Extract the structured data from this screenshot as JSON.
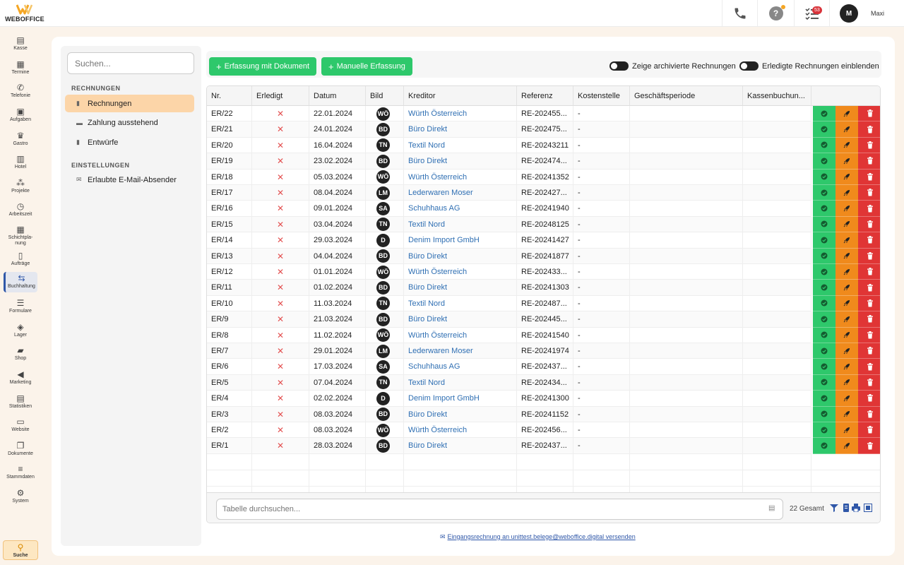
{
  "app": {
    "brand": "WEBOFFICE",
    "accent": "#f5a623"
  },
  "topbar": {
    "notification_count": "53",
    "user_initial": "M",
    "user_name": "Maxi",
    "icons": [
      "phone-icon",
      "help-icon",
      "tasks-icon",
      "avatar"
    ]
  },
  "sidenav": {
    "items": [
      {
        "label": "Kasse",
        "icon": "register-icon"
      },
      {
        "label": "Termine",
        "icon": "calendar-icon"
      },
      {
        "label": "Telefonie",
        "icon": "phone-icon"
      },
      {
        "label": "Aufgaben",
        "icon": "tasks-icon"
      },
      {
        "label": "Gastro",
        "icon": "crown-icon"
      },
      {
        "label": "Hotel",
        "icon": "hotel-icon"
      },
      {
        "label": "Projekte",
        "icon": "projects-icon"
      },
      {
        "label": "Arbeitszeit",
        "icon": "clock-icon"
      },
      {
        "label": "Schichtpla-nung",
        "icon": "shift-icon"
      },
      {
        "label": "Aufträge",
        "icon": "orders-icon"
      },
      {
        "label": "Buchhaltung",
        "icon": "accounting-icon",
        "active": true
      },
      {
        "label": "Formulare",
        "icon": "forms-icon"
      },
      {
        "label": "Lager",
        "icon": "storage-icon"
      },
      {
        "label": "Shop",
        "icon": "shop-icon"
      },
      {
        "label": "Marketing",
        "icon": "megaphone-icon"
      },
      {
        "label": "Statistiken",
        "icon": "stats-icon"
      },
      {
        "label": "Website",
        "icon": "website-icon"
      },
      {
        "label": "Dokumente",
        "icon": "documents-icon"
      },
      {
        "label": "Stammdaten",
        "icon": "database-icon"
      },
      {
        "label": "System",
        "icon": "gear-icon"
      }
    ],
    "search_label": "Suche"
  },
  "leftpanel": {
    "search_placeholder": "Suchen...",
    "section_invoices": "RECHNUNGEN",
    "items": [
      "Rechnungen",
      "Zahlung ausstehend",
      "Entwürfe"
    ],
    "section_settings": "EINSTELLUNGEN",
    "settings_items": [
      "Erlaubte E-Mail-Absender"
    ]
  },
  "toolbar": {
    "btn_document": "Erfassung mit Dokument",
    "btn_manual": "Manuelle Erfassung",
    "toggle_archived": "Zeige archivierte Rechnungen",
    "toggle_done": "Erledigte Rechnungen einblenden"
  },
  "table": {
    "columns": [
      "Nr.",
      "Erledigt",
      "Datum",
      "Bild",
      "Kreditor",
      "Referenz",
      "Kostenstelle",
      "Geschäftsperiode",
      "Kassenbuchun..."
    ],
    "rows": [
      {
        "nr": "ER/22",
        "done": "✕",
        "date": "22.01.2024",
        "img": "WÖ",
        "creditor": "Würth Österreich",
        "ref": "RE-202455...",
        "cost": "-"
      },
      {
        "nr": "ER/21",
        "done": "✕",
        "date": "24.01.2024",
        "img": "BD",
        "creditor": "Büro Direkt",
        "ref": "RE-202475...",
        "cost": "-"
      },
      {
        "nr": "ER/20",
        "done": "✕",
        "date": "16.04.2024",
        "img": "TN",
        "creditor": "Textil Nord",
        "ref": "RE-20243211",
        "cost": "-"
      },
      {
        "nr": "ER/19",
        "done": "✕",
        "date": "23.02.2024",
        "img": "BD",
        "creditor": "Büro Direkt",
        "ref": "RE-202474...",
        "cost": "-"
      },
      {
        "nr": "ER/18",
        "done": "✕",
        "date": "05.03.2024",
        "img": "WÖ",
        "creditor": "Würth Österreich",
        "ref": "RE-20241352",
        "cost": "-"
      },
      {
        "nr": "ER/17",
        "done": "✕",
        "date": "08.04.2024",
        "img": "LM",
        "creditor": "Lederwaren Moser",
        "ref": "RE-202427...",
        "cost": "-"
      },
      {
        "nr": "ER/16",
        "done": "✕",
        "date": "09.01.2024",
        "img": "SA",
        "creditor": "Schuhhaus AG",
        "ref": "RE-20241940",
        "cost": "-"
      },
      {
        "nr": "ER/15",
        "done": "✕",
        "date": "03.04.2024",
        "img": "TN",
        "creditor": "Textil Nord",
        "ref": "RE-20248125",
        "cost": "-"
      },
      {
        "nr": "ER/14",
        "done": "✕",
        "date": "29.03.2024",
        "img": "D",
        "creditor": "Denim Import GmbH",
        "ref": "RE-20241427",
        "cost": "-"
      },
      {
        "nr": "ER/13",
        "done": "✕",
        "date": "04.04.2024",
        "img": "BD",
        "creditor": "Büro Direkt",
        "ref": "RE-20241877",
        "cost": "-"
      },
      {
        "nr": "ER/12",
        "done": "✕",
        "date": "01.01.2024",
        "img": "WÖ",
        "creditor": "Würth Österreich",
        "ref": "RE-202433...",
        "cost": "-"
      },
      {
        "nr": "ER/11",
        "done": "✕",
        "date": "01.02.2024",
        "img": "BD",
        "creditor": "Büro Direkt",
        "ref": "RE-20241303",
        "cost": "-"
      },
      {
        "nr": "ER/10",
        "done": "✕",
        "date": "11.03.2024",
        "img": "TN",
        "creditor": "Textil Nord",
        "ref": "RE-202487...",
        "cost": "-"
      },
      {
        "nr": "ER/9",
        "done": "✕",
        "date": "21.03.2024",
        "img": "BD",
        "creditor": "Büro Direkt",
        "ref": "RE-202445...",
        "cost": "-"
      },
      {
        "nr": "ER/8",
        "done": "✕",
        "date": "11.02.2024",
        "img": "WÖ",
        "creditor": "Würth Österreich",
        "ref": "RE-20241540",
        "cost": "-"
      },
      {
        "nr": "ER/7",
        "done": "✕",
        "date": "29.01.2024",
        "img": "LM",
        "creditor": "Lederwaren Moser",
        "ref": "RE-20241974",
        "cost": "-"
      },
      {
        "nr": "ER/6",
        "done": "✕",
        "date": "17.03.2024",
        "img": "SA",
        "creditor": "Schuhhaus AG",
        "ref": "RE-202437...",
        "cost": "-"
      },
      {
        "nr": "ER/5",
        "done": "✕",
        "date": "07.04.2024",
        "img": "TN",
        "creditor": "Textil Nord",
        "ref": "RE-202434...",
        "cost": "-"
      },
      {
        "nr": "ER/4",
        "done": "✕",
        "date": "02.02.2024",
        "img": "D",
        "creditor": "Denim Import GmbH",
        "ref": "RE-20241300",
        "cost": "-"
      },
      {
        "nr": "ER/3",
        "done": "✕",
        "date": "08.03.2024",
        "img": "BD",
        "creditor": "Büro Direkt",
        "ref": "RE-20241152",
        "cost": "-"
      },
      {
        "nr": "ER/2",
        "done": "✕",
        "date": "08.03.2024",
        "img": "WÖ",
        "creditor": "Würth Österreich",
        "ref": "RE-202456...",
        "cost": "-"
      },
      {
        "nr": "ER/1",
        "done": "✕",
        "date": "28.03.2024",
        "img": "BD",
        "creditor": "Büro Direkt",
        "ref": "RE-202437...",
        "cost": "-"
      }
    ],
    "row_actions": [
      "approve-icon",
      "rocket-icon",
      "trash-icon"
    ],
    "action_colors": {
      "approve": "#2ec86b",
      "rocket": "#f08a1c",
      "delete": "#e03535"
    },
    "search_placeholder": "Tabelle durchsuchen...",
    "total": "22 Gesamt"
  },
  "footer": {
    "mail_note": "Eingangsrechnung an unittest.belege@weboffice.digital versenden"
  }
}
